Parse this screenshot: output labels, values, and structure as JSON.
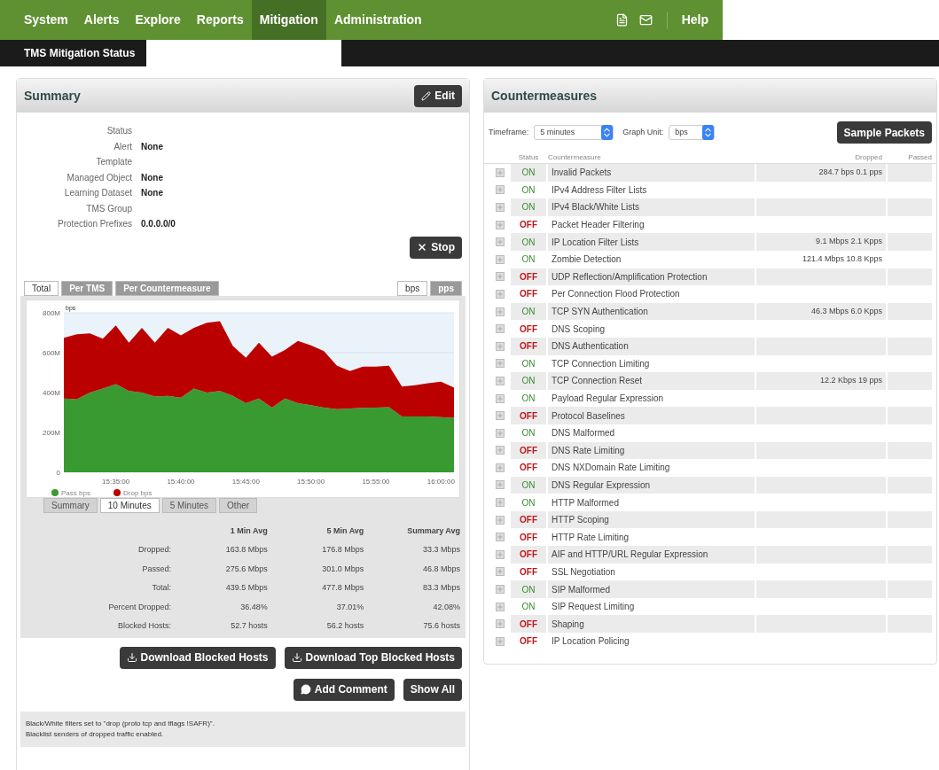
{
  "nav": {
    "items": [
      {
        "label": "System",
        "selected": false
      },
      {
        "label": "Alerts",
        "selected": false
      },
      {
        "label": "Explore",
        "selected": false
      },
      {
        "label": "Reports",
        "selected": false
      },
      {
        "label": "Mitigation",
        "selected": true
      },
      {
        "label": "Administration",
        "selected": false
      }
    ],
    "help": "Help"
  },
  "page_tab": "TMS Mitigation Status",
  "summary": {
    "title": "Summary",
    "edit_button": "Edit",
    "stop_button": "Stop",
    "fields": [
      {
        "label": "Status"
      },
      {
        "label": "Alert",
        "value": "None"
      },
      {
        "label": "Template"
      },
      {
        "label": "Managed Object",
        "value": "None"
      },
      {
        "label": "Learning Dataset",
        "value": "None"
      },
      {
        "label": "TMS Group"
      },
      {
        "label": "Protection Prefixes",
        "value": "0.0.0.0/0"
      }
    ],
    "graph_tabs": [
      {
        "label": "Total",
        "selected": true
      },
      {
        "label": "Per TMS",
        "selected": false
      },
      {
        "label": "Per Countermeasure",
        "selected": false
      }
    ],
    "unit_tabs": [
      {
        "label": "bps",
        "selected": true
      },
      {
        "label": "pps",
        "selected": false
      }
    ],
    "chart_data": {
      "type": "area",
      "stacked": true,
      "legend": "bottom",
      "ylabel": "bps",
      "ylim": [
        0,
        800
      ],
      "categories": [
        null,
        null,
        null,
        null,
        "15:35:00",
        null,
        null,
        null,
        null,
        "15:40:00",
        null,
        null,
        null,
        null,
        "15:45:00",
        null,
        null,
        null,
        null,
        "15:50:00",
        null,
        null,
        null,
        null,
        "15:55:00",
        null,
        null,
        null,
        null,
        "16:00:00",
        null
      ],
      "yticks": [
        {
          "value": 0,
          "label": "0"
        },
        {
          "value": 200,
          "label": "200M"
        },
        {
          "value": 400,
          "label": "400M"
        },
        {
          "value": 600,
          "label": "600M"
        },
        {
          "value": 800,
          "label": "800M"
        }
      ],
      "series": [
        {
          "name": "Pass bps",
          "color": "#3a9a32",
          "values": [
            370,
            367,
            400,
            420,
            442,
            408,
            400,
            380,
            383,
            375,
            420,
            400,
            408,
            383,
            347,
            370,
            325,
            370,
            347,
            337,
            325,
            317,
            320,
            323,
            325,
            327,
            280,
            280,
            280,
            277,
            273
          ]
        },
        {
          "name": "Drop bps",
          "color": "#bb0000",
          "values": [
            305,
            325,
            297,
            250,
            295,
            242,
            325,
            270,
            342,
            312,
            305,
            350,
            350,
            250,
            228,
            280,
            255,
            243,
            312,
            300,
            283,
            217,
            188,
            207,
            205,
            207,
            150,
            157,
            167,
            177,
            152
          ]
        }
      ]
    },
    "range_tabs": [
      {
        "label": "Summary",
        "selected": false
      },
      {
        "label": "10 Minutes",
        "selected": true
      },
      {
        "label": "5 Minutes",
        "selected": false
      },
      {
        "label": "Other",
        "selected": false
      }
    ],
    "stats": {
      "columns": [
        "1 Min Avg",
        "5 Min Avg",
        "Summary Avg"
      ],
      "rows": [
        {
          "label": "Dropped:",
          "cells": [
            "163.8 Mbps",
            "176.8 Mbps",
            "33.3 Mbps"
          ]
        },
        {
          "label": "Passed:",
          "cells": [
            "275.6 Mbps",
            "301.0 Mbps",
            "46.8 Mbps"
          ]
        },
        {
          "label": "Total:",
          "cells": [
            "439.5 Mbps",
            "477.8 Mbps",
            "83.3 Mbps"
          ]
        },
        {
          "label": "Percent Dropped:",
          "cells": [
            "36.48%",
            "37.01%",
            "42.08%"
          ]
        },
        {
          "label": "Blocked Hosts:",
          "cells": [
            "52.7 hosts",
            "56.2 hosts",
            "75.6 hosts"
          ]
        }
      ]
    },
    "download_buttons": [
      "Download Blocked Hosts",
      "Download Top Blocked Hosts"
    ],
    "add_comment": "Add Comment",
    "show_all": "Show All",
    "notes": [
      "Black/White filters set to \"drop (proto tcp and tflags !SAFR)\".",
      "Blacklist senders of dropped traffic enabled."
    ]
  },
  "countermeasures": {
    "title": "Countermeasures",
    "timeframe_label": "Timeframe:",
    "timeframe": "5 minutes",
    "unit_label": "Graph Unit:",
    "unit": "bps",
    "sample_button": "Sample Packets",
    "columns": [
      "Status",
      "Countermeasure",
      "Dropped",
      "Passed"
    ],
    "rows": [
      {
        "status": "ON",
        "on": true,
        "name": "Invalid Packets",
        "dropped": "284.7 bps 0.1 pps"
      },
      {
        "status": "ON",
        "on": true,
        "name": "IPv4 Address Filter Lists"
      },
      {
        "status": "ON",
        "on": true,
        "name": "IPv4 Black/White Lists"
      },
      {
        "status": "OFF",
        "on": false,
        "name": "Packet Header Filtering"
      },
      {
        "status": "ON",
        "on": true,
        "name": "IP Location Filter Lists",
        "dropped": "9.1 Mbps 2.1 Kpps"
      },
      {
        "status": "ON",
        "on": true,
        "name": "Zombie Detection",
        "dropped": "121.4 Mbps 10.8 Kpps"
      },
      {
        "status": "OFF",
        "on": false,
        "name": "UDP Reflection/Amplification Protection"
      },
      {
        "status": "OFF",
        "on": false,
        "name": "Per Connection Flood Protection"
      },
      {
        "status": "ON",
        "on": true,
        "name": "TCP SYN Authentication",
        "dropped": "46.3 Mbps 6.0 Kpps"
      },
      {
        "status": "OFF",
        "on": false,
        "name": "DNS Scoping"
      },
      {
        "status": "OFF",
        "on": false,
        "name": "DNS Authentication"
      },
      {
        "status": "ON",
        "on": true,
        "name": "TCP Connection Limiting"
      },
      {
        "status": "ON",
        "on": true,
        "name": "TCP Connection Reset",
        "dropped": "12.2 Kbps 19 pps"
      },
      {
        "status": "ON",
        "on": true,
        "name": "Payload Regular Expression"
      },
      {
        "status": "OFF",
        "on": false,
        "name": "Protocol Baselines"
      },
      {
        "status": "ON",
        "on": true,
        "name": "DNS Malformed"
      },
      {
        "status": "OFF",
        "on": false,
        "name": "DNS Rate Limiting"
      },
      {
        "status": "OFF",
        "on": false,
        "name": "DNS NXDomain Rate Limiting"
      },
      {
        "status": "ON",
        "on": true,
        "name": "DNS Regular Expression"
      },
      {
        "status": "ON",
        "on": true,
        "name": "HTTP Malformed"
      },
      {
        "status": "OFF",
        "on": false,
        "name": "HTTP Scoping"
      },
      {
        "status": "OFF",
        "on": false,
        "name": "HTTP Rate Limiting"
      },
      {
        "status": "OFF",
        "on": false,
        "name": "AIF and HTTP/URL Regular Expression"
      },
      {
        "status": "OFF",
        "on": false,
        "name": "SSL Negotiation"
      },
      {
        "status": "ON",
        "on": true,
        "name": "SIP Malformed"
      },
      {
        "status": "ON",
        "on": true,
        "name": "SIP Request Limiting"
      },
      {
        "status": "OFF",
        "on": false,
        "name": "Shaping"
      },
      {
        "status": "OFF",
        "on": false,
        "name": "IP Location Policing"
      }
    ]
  }
}
